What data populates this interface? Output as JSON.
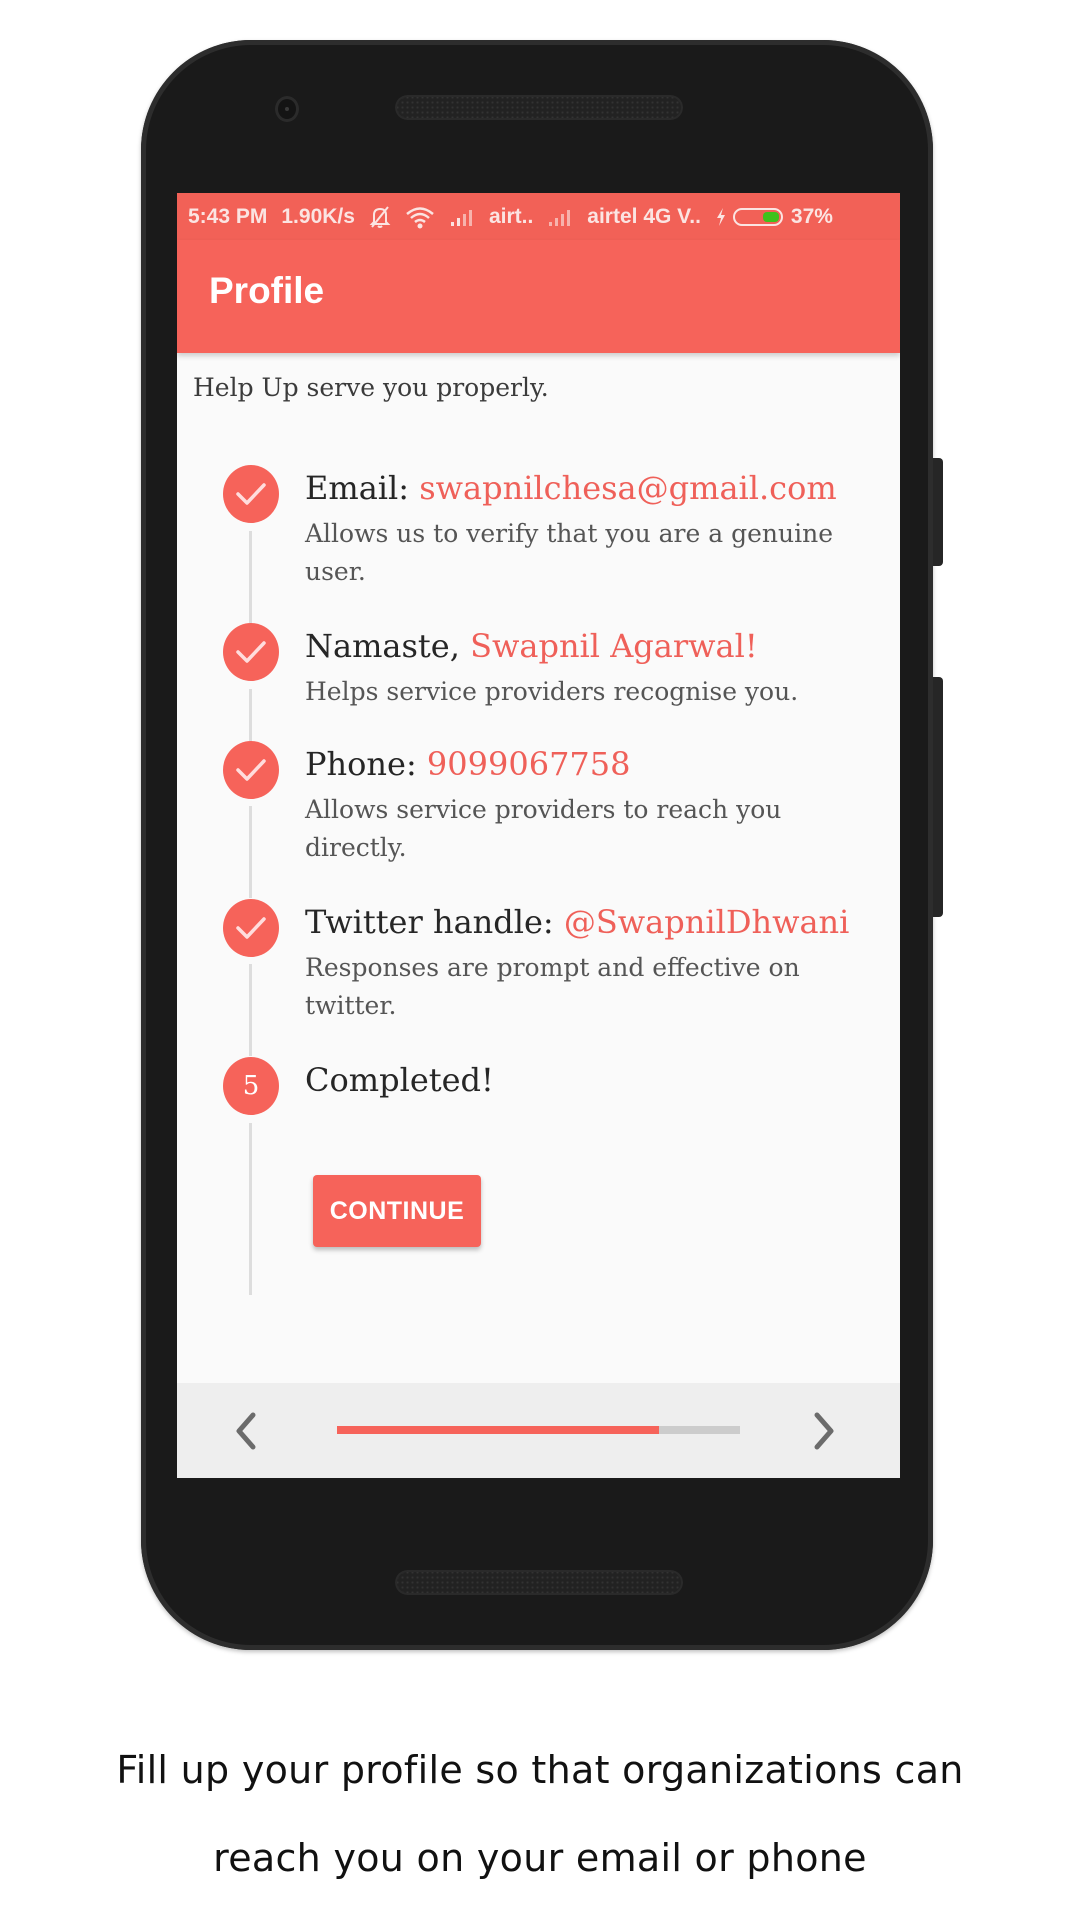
{
  "status_bar": {
    "time": "5:43 PM",
    "net_speed": "1.90K/s",
    "icons": [
      "notifications-off-icon",
      "wifi-icon",
      "signal-icon"
    ],
    "carrier_1": "airt..",
    "carrier_2": "airtel 4G V..",
    "charging_icon": "bolt-icon",
    "battery_percent": "37%",
    "battery_level": 0.37
  },
  "app_bar": {
    "title": "Profile"
  },
  "content": {
    "intro": "Help Up serve you properly.",
    "steps": [
      {
        "status": "done",
        "icon": "check-icon",
        "label": "Email: ",
        "value": "swapnilchesa@gmail.com",
        "description": "Allows us to verify that you are a genuine user."
      },
      {
        "status": "done",
        "icon": "check-icon",
        "label": "Namaste, ",
        "value": "Swapnil Agarwal!",
        "description": "Helps service providers recognise you."
      },
      {
        "status": "done",
        "icon": "check-icon",
        "label": "Phone: ",
        "value": "9099067758",
        "description": "Allows service providers to reach you directly."
      },
      {
        "status": "done",
        "icon": "check-icon",
        "label": "Twitter handle: ",
        "value": "@SwapnilDhwani",
        "description": "Responses are prompt and effective on twitter."
      },
      {
        "status": "active",
        "number": "5",
        "label": "Completed!",
        "value": "",
        "description": ""
      }
    ],
    "continue_label": "CONTINUE"
  },
  "bottom_nav": {
    "prev_icon": "chevron-left-icon",
    "next_icon": "chevron-right-icon",
    "progress": 0.8
  },
  "caption": {
    "line1": "Fill up your profile so that organizations can",
    "line2": "reach you on your email or phone"
  },
  "colors": {
    "accent": "#f6635a",
    "status_bar": "#f26157",
    "background": "#fafafa",
    "battery_fill": "#3fc21c"
  }
}
